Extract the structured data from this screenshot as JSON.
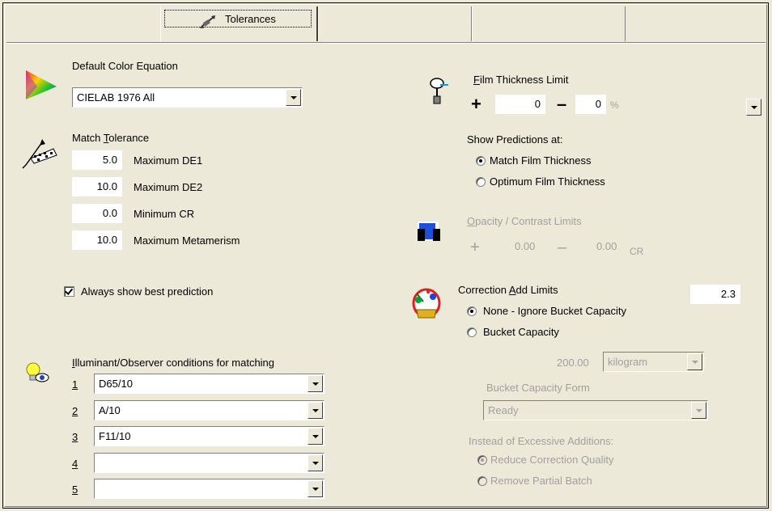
{
  "tab": {
    "label": "Tolerances"
  },
  "color_equation": {
    "label": "Default Color Equation",
    "value": "CIELAB 1976  All"
  },
  "match_tolerance": {
    "label": "Match Tolerance",
    "rows": [
      {
        "value": "5.0",
        "label": "Maximum DE1"
      },
      {
        "value": "10.0",
        "label": "Maximum DE2"
      },
      {
        "value": "0.0",
        "label": "Minimum CR"
      },
      {
        "value": "10.0",
        "label": "Maximum Metamerism"
      }
    ]
  },
  "best_prediction": {
    "label": "Always show best prediction",
    "checked": true
  },
  "illuminant": {
    "label": "Illuminant/Observer conditions for matching",
    "rows": [
      {
        "num": "1",
        "value": "D65/10"
      },
      {
        "num": "2",
        "value": "A/10"
      },
      {
        "num": "3",
        "value": "F11/10"
      },
      {
        "num": "4",
        "value": ""
      },
      {
        "num": "5",
        "value": ""
      }
    ]
  },
  "film_thickness": {
    "label": "Film Thickness Limit",
    "plus_sign": "+",
    "minus_sign": "–",
    "plus_value": "0",
    "minus_value": "0",
    "unit": "%"
  },
  "show_predictions": {
    "label": "Show Predictions at:",
    "options": [
      {
        "label": "Match Film Thickness",
        "checked": true
      },
      {
        "label": "Optimum Film Thickness",
        "checked": false
      }
    ]
  },
  "opacity": {
    "label": "Opacity / Contrast Limits",
    "plus_sign": "+",
    "minus_sign": "–",
    "plus_value": "0.00",
    "minus_value": "0.00",
    "unit": "CR"
  },
  "correction": {
    "label": "Correction Add Limits",
    "value": "2.3",
    "options": [
      {
        "label": "None - Ignore Bucket Capacity",
        "checked": true
      },
      {
        "label": "Bucket Capacity",
        "checked": false
      }
    ],
    "capacity_value": "200.00",
    "capacity_unit": "kilogram",
    "form_label": "Bucket Capacity Form",
    "form_value": "Ready",
    "excess_label": "Instead of Excessive Additions:",
    "excess_options": [
      {
        "label": "Reduce Correction Quality",
        "checked": true
      },
      {
        "label": "Remove Partial Batch",
        "checked": false
      }
    ]
  },
  "colors": {
    "background": "#ece9d8",
    "disabled_text": "#a0a0a0"
  },
  "icons": [
    "color-triangle-icon",
    "tolerance-icon",
    "bulb-eye-icon",
    "film-thickness-icon",
    "opacity-icon",
    "correction-icon",
    "tolerances-tab-icon"
  ]
}
